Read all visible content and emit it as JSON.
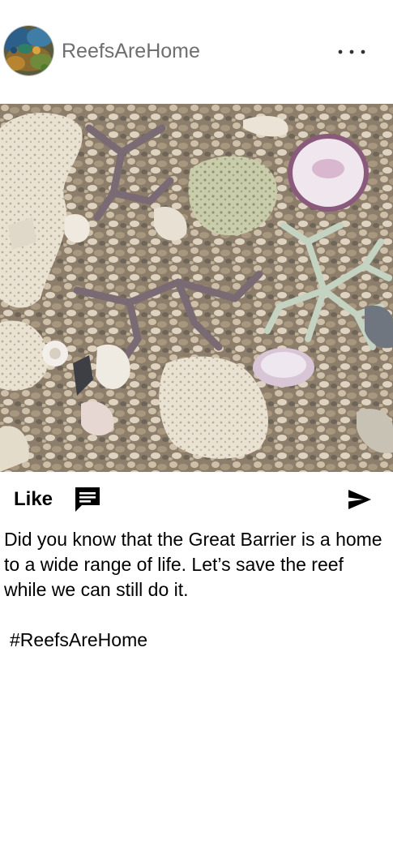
{
  "post": {
    "username": "ReefsAreHome",
    "avatar_icon": "reef-avatar",
    "more_icon": "more-horizontal-icon",
    "image_icon": "coral-rubble-photo"
  },
  "actions": {
    "like_label": "Like",
    "comment_icon": "comment-icon",
    "share_icon": "send-icon"
  },
  "caption": {
    "text": "Did you know that the Great Barrier is a home to a wide range of life. Let’s save the reef while we can still do it.",
    "hashtag": "#ReefsAreHome"
  },
  "colors": {
    "username": "#6f6f6f",
    "background": "#ffffff",
    "text": "#000000"
  }
}
